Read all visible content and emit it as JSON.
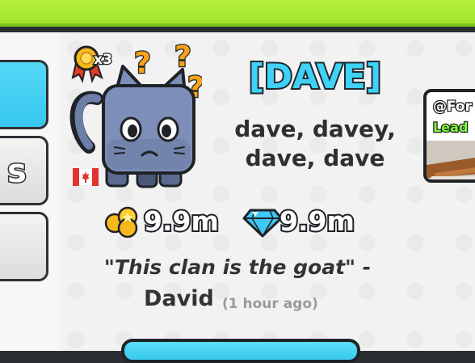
{
  "left_tabs": [
    {
      "label": ""
    },
    {
      "label": "s"
    },
    {
      "label": ""
    }
  ],
  "clan": {
    "name": "[DAVE]",
    "description_line1": "dave, davey,",
    "description_line2": "dave, dave",
    "badge_count": "x3",
    "flag": "canada-flag"
  },
  "stats": {
    "coins": "9.9m",
    "diamonds": "9.9m"
  },
  "quote": {
    "text": "\"This clan is the goat\" -",
    "author": "David",
    "time": "(1 hour ago)"
  },
  "leaderboard_card": {
    "handle": "@For",
    "subtitle": "Lead"
  },
  "icons": {
    "medal": "medal-icon",
    "coins": "coins-icon",
    "diamond": "diamond-icon"
  },
  "colors": {
    "accent": "#3fd2f6",
    "banner": "#a8e832",
    "panel": "#f2f2f2"
  }
}
